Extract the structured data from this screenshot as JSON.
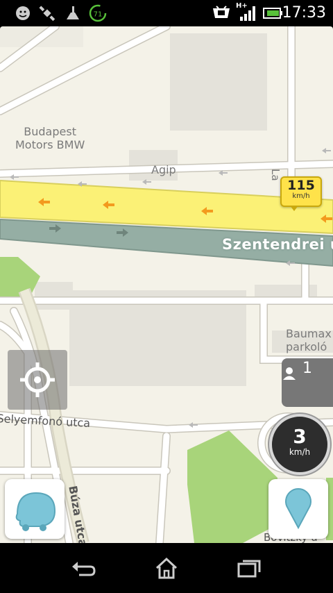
{
  "status_bar": {
    "time": "17:33",
    "battery_badge": "71",
    "network": "H+",
    "icons": [
      "waze-icon",
      "satellite-icon",
      "cleaner-icon",
      "battery-saver-icon",
      "tv-icon",
      "signal-icon",
      "battery-icon"
    ]
  },
  "map": {
    "poi_budapest_motors": "Budapest\nMotors BMW",
    "poi_agip": "Agip",
    "poi_baumax": "Baumax\nparkoló",
    "street_szentendrei": "Szentendrei út",
    "street_selyemfono": "Selyemfonó utca",
    "street_buza": "Búza utca",
    "street_la": "La",
    "street_bovitzky": "Bovitzky u",
    "colors": {
      "background": "#f4f2e8",
      "road": "#ffffff",
      "highway": "#fbf176",
      "highway_opposite": "#95aea4",
      "park": "#a8d47a",
      "building": "#e4e2da"
    }
  },
  "speed_limit_flag": {
    "value": "115",
    "unit": "km/h"
  },
  "users_panel": {
    "count": "1"
  },
  "speedometer": {
    "value": "3",
    "unit": "km/h"
  },
  "nav": {
    "back": "back-icon",
    "home": "home-icon",
    "recents": "recents-icon"
  }
}
